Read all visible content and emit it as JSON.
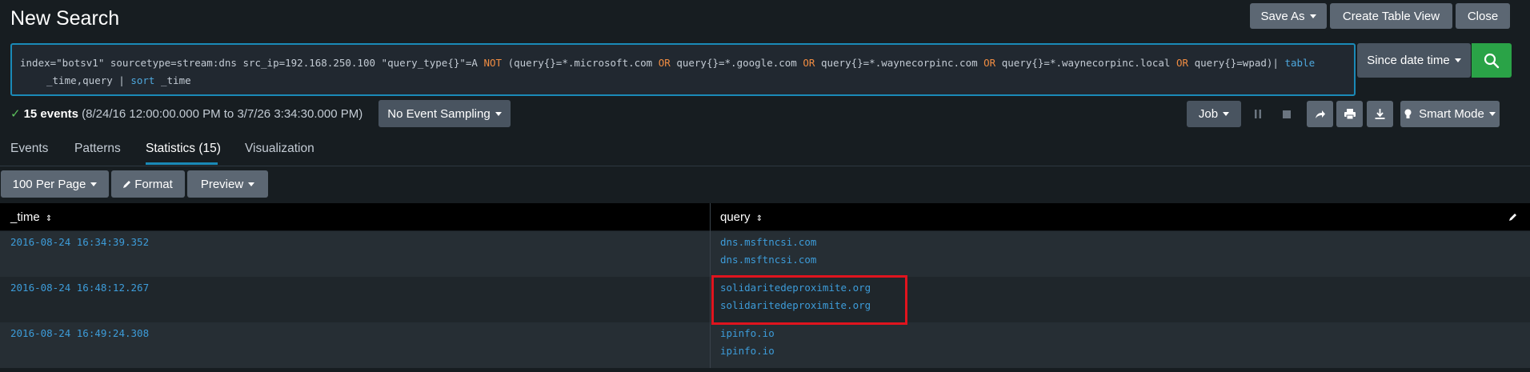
{
  "header": {
    "title": "New Search",
    "save_as": "Save As",
    "create_table_view": "Create Table View",
    "close": "Close"
  },
  "search": {
    "parts": {
      "p1": "index=\"botsv1\" sourcetype=stream:dns src_ip=192.168.250.100 \"query_type{}\"=A ",
      "not": "NOT",
      "p2": " (query{}=*.microsoft.com ",
      "or1": "OR",
      "p3": " query{}=*.google.com ",
      "or2": "OR",
      "p4": " query{}=*.waynecorpinc.com ",
      "or3": "OR",
      "p5": " query{}=*.waynecorpinc.local ",
      "or4": "OR",
      "p6": " query{}=wpad)| ",
      "table": "table",
      "p7": "_time,query | ",
      "sort": "sort",
      "p8": " _time"
    },
    "time_picker": "Since date time",
    "search_icon": "search-icon"
  },
  "status": {
    "count": "15 events",
    "range": "(8/24/16 12:00:00.000 PM to 3/7/26 3:34:30.000 PM)",
    "sampling": "No Event Sampling"
  },
  "job": {
    "job_label": "Job",
    "mode": "Smart Mode",
    "icons": [
      "pause-icon",
      "stop-icon",
      "share-icon",
      "print-icon",
      "export-icon",
      "bulb-icon"
    ]
  },
  "tabs": [
    {
      "label": "Events"
    },
    {
      "label": "Patterns"
    },
    {
      "label": "Statistics (15)"
    },
    {
      "label": "Visualization"
    }
  ],
  "table_controls": {
    "per_page": "100 Per Page",
    "format": "Format",
    "preview": "Preview"
  },
  "table": {
    "columns": [
      "_time",
      "query"
    ],
    "rows": [
      {
        "time": "2016-08-24 16:34:39.352",
        "query": [
          "dns.msftncsi.com",
          "dns.msftncsi.com"
        ]
      },
      {
        "time": "2016-08-24 16:48:12.267",
        "query": [
          "solidaritedeproximite.org",
          "solidaritedeproximite.org"
        ]
      },
      {
        "time": "2016-08-24 16:49:24.308",
        "query": [
          "ipinfo.io",
          "ipinfo.io"
        ]
      }
    ]
  },
  "colors": {
    "accent": "#1a8ab8",
    "search_button": "#2aa347",
    "highlight_box": "#e0141e",
    "link": "#3d9cd9"
  }
}
